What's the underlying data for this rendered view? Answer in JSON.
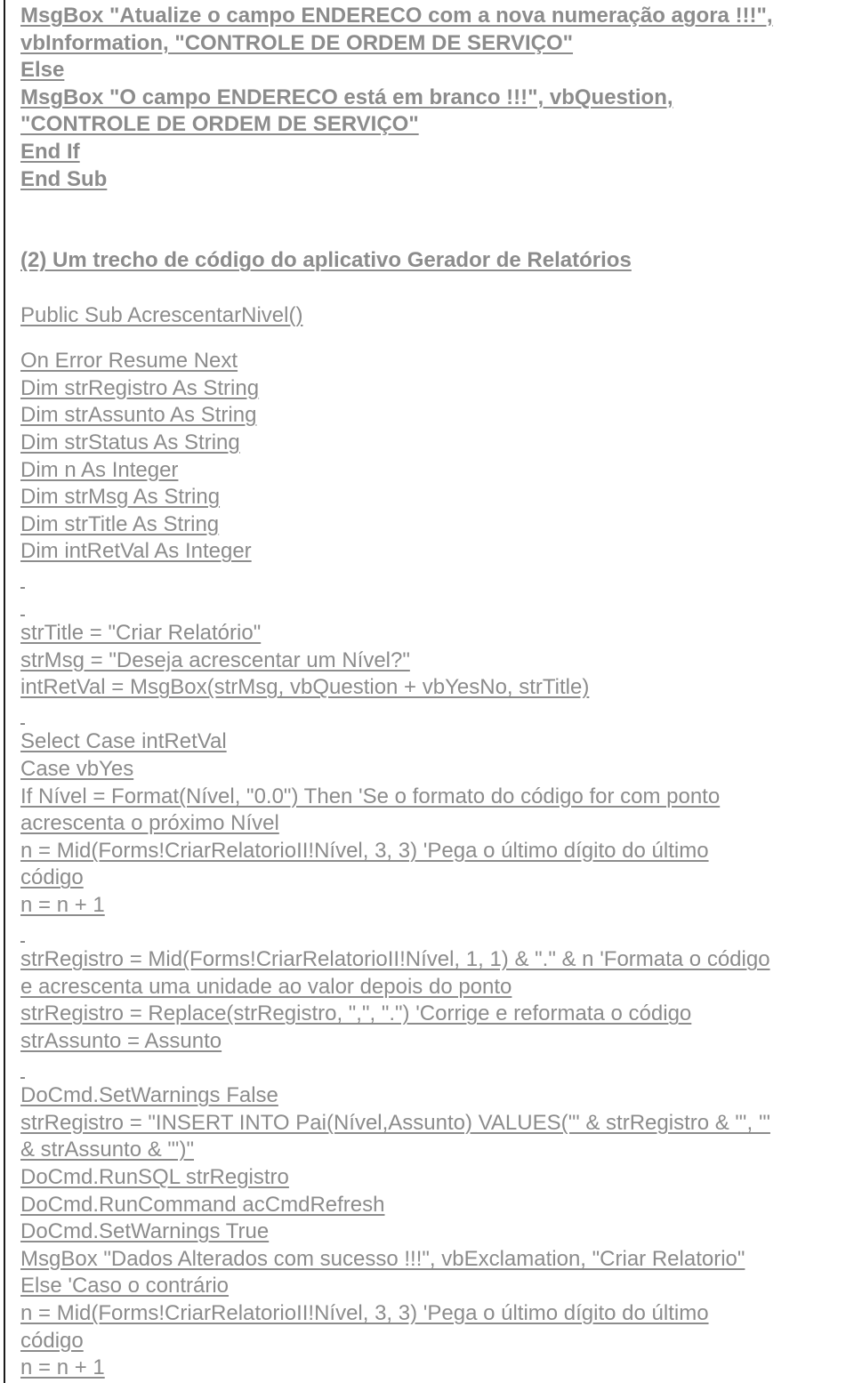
{
  "top_block": [
    "MsgBox \"Atualize o campo ENDERECO com a nova numeração agora !!!\",",
    "vbInformation, \"CONTROLE DE ORDEM DE SERVIÇO\"",
    "Else",
    "MsgBox \"O campo ENDERECO está em branco !!!\", vbQuestion,",
    "\"CONTROLE DE ORDEM DE SERVIÇO\"",
    "End If",
    "End Sub"
  ],
  "section_heading": "(2) Um trecho de código do aplicativo Gerador de Relatórios",
  "sub_declaration": "Public Sub AcrescentarNivel()",
  "code_lines": [
    "On Error Resume Next",
    "Dim strRegistro As String",
    "Dim strAssunto As String",
    "Dim strStatus As String",
    "Dim n As Integer",
    "Dim strMsg As String",
    "Dim strTitle As String",
    "Dim intRetVal As Integer",
    "",
    "",
    "strTitle = \"Criar Relatório\"",
    "strMsg = \"Deseja acrescentar um Nível?\"",
    "intRetVal = MsgBox(strMsg, vbQuestion + vbYesNo, strTitle)",
    "",
    "Select Case intRetVal",
    "Case vbYes",
    "If Nível = Format(Nível, \"0.0\") Then 'Se o formato do código for com ponto",
    "acrescenta o próximo Nível",
    "n = Mid(Forms!CriarRelatorioII!Nível, 3, 3) 'Pega o último dígito do último",
    "código",
    "n = n + 1",
    "",
    "strRegistro = Mid(Forms!CriarRelatorioII!Nível, 1, 1) & \".\" & n 'Formata o código",
    "e acrescenta uma unidade ao valor depois do ponto",
    "strRegistro = Replace(strRegistro, \",\", \".\") 'Corrige e reformata o código",
    "strAssunto = Assunto",
    "",
    "DoCmd.SetWarnings False",
    "strRegistro = \"INSERT INTO Pai(Nível,Assunto) VALUES('\" & strRegistro & \"', '\"",
    "& strAssunto & \"')\"",
    "DoCmd.RunSQL strRegistro",
    "DoCmd.RunCommand acCmdRefresh",
    "DoCmd.SetWarnings True",
    "MsgBox \"Dados Alterados com sucesso !!!\", vbExclamation, \"Criar Relatorio\"",
    "Else 'Caso o contrário",
    "n = Mid(Forms!CriarRelatorioII!Nível, 3, 3) 'Pega o último dígito do último",
    "código",
    "n = n + 1"
  ]
}
